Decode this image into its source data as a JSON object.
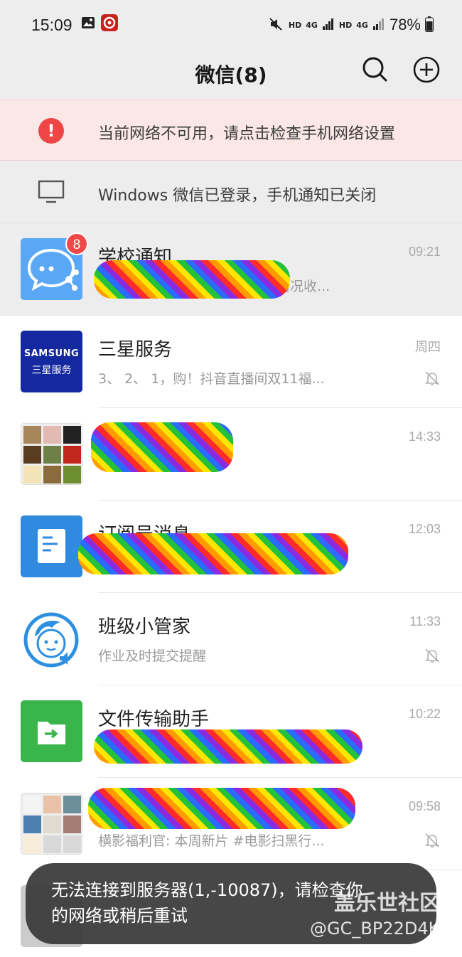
{
  "status_bar": {
    "time": "15:09",
    "hd1": "HD",
    "net1": "4G",
    "hd2": "HD",
    "net2": "4G",
    "battery": "78%"
  },
  "nav": {
    "title": "微信(8)"
  },
  "network_alert": {
    "text": "当前网络不可用，请点击检查手机网络设置"
  },
  "pc_login": {
    "text": "Windows 微信已登录，手机通知已关闭"
  },
  "chats": [
    {
      "name": "学校通知",
      "preview": "康情况收...",
      "time": "09:21",
      "badge": "8"
    },
    {
      "name": "三星服务",
      "preview": "3、 2、 1，购！抖音直播间双11福...",
      "time": "周四",
      "avatar_line1": "SAMSUNG",
      "avatar_line2": "三星服务"
    },
    {
      "name": "",
      "preview": "",
      "time": "14:33"
    },
    {
      "name": "订阅号消息",
      "preview": "",
      "time": "12:03"
    },
    {
      "name": "班级小管家",
      "preview": "作业及时提交提醒",
      "time": "11:33"
    },
    {
      "name": "文件传输助手",
      "preview": "",
      "time": "10:22"
    },
    {
      "name": "",
      "preview": "横影福利官: 本周新片 #电影扫黑行...",
      "time": "09:58"
    }
  ],
  "toast": {
    "line1": "无法连接到服务器(1,-10087)，请检查你",
    "line2": "的网络或稍后重试"
  },
  "watermark": {
    "brand": "盖乐世社区",
    "user": "@GC_BP22D4K"
  },
  "colors": {
    "alert_red": "#ee4646",
    "badge_red": "#f04848",
    "wechat_green": "#39b54a",
    "samsung_blue": "#1428a0",
    "school_blue": "#5aa8f5"
  }
}
